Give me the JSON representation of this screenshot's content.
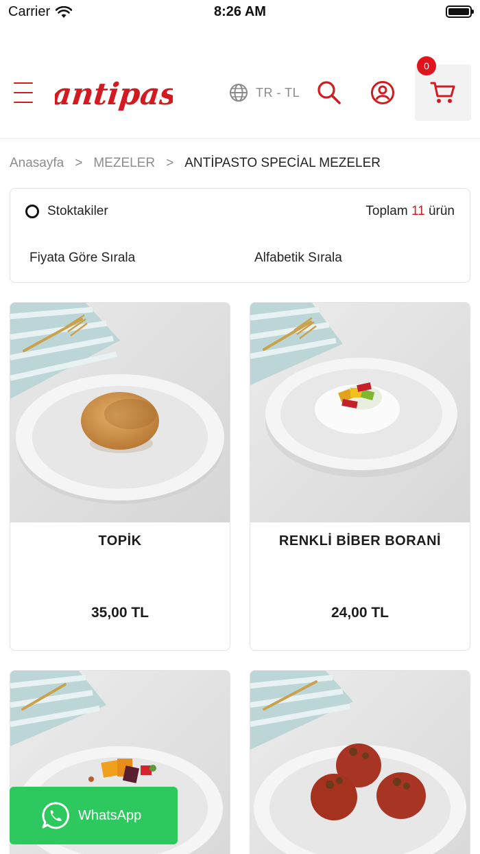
{
  "status_bar": {
    "carrier": "Carrier",
    "time": "8:26 AM"
  },
  "header": {
    "logo_text": "antipasto",
    "language": "TR - TL",
    "cart_count": "0",
    "accent_color": "#d31a20"
  },
  "breadcrumb": {
    "items": [
      "Anasayfa",
      "MEZELER",
      "ANTİPASTO SPECİAL MEZELER"
    ],
    "separator": ">"
  },
  "filters": {
    "stock_label": "Stoktakiler",
    "total_prefix": "Toplam",
    "total_count": "11",
    "total_suffix": "ürün",
    "sort_price": "Fiyata Göre Sırala",
    "sort_alpha": "Alfabetik Sırala"
  },
  "products": [
    {
      "name": "TOPİK",
      "price": "35,00 TL"
    },
    {
      "name": "RENKLİ BİBER BORANİ",
      "price": "24,00 TL"
    },
    {
      "name": "",
      "price": ""
    },
    {
      "name": "",
      "price": ""
    }
  ],
  "whatsapp": {
    "label": "WhatsApp",
    "color": "#2dc95f"
  },
  "icons": [
    "wifi-icon",
    "battery-icon",
    "menu-icon",
    "globe-icon",
    "search-icon",
    "user-icon",
    "cart-icon",
    "whatsapp-icon"
  ]
}
